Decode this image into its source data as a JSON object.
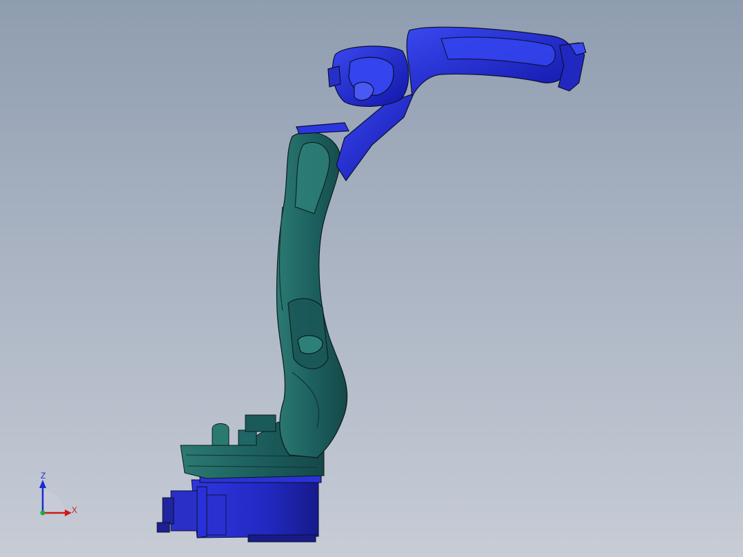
{
  "viewport": {
    "background_top": "#8f9db0",
    "background_bottom": "#c7ccd6"
  },
  "model": {
    "colors": {
      "upper_arm": "#1b22d6",
      "upper_arm_highlight": "#3a48f0",
      "lower_arm": "#1d6060",
      "lower_arm_highlight": "#2f7f78",
      "base": "#2326c8",
      "edge": "#0a1030"
    }
  },
  "triad": {
    "z_label": "Z",
    "x_label": "X",
    "z_color": "#1a2bd0",
    "x_color": "#d01818",
    "origin_color": "#18b030"
  }
}
